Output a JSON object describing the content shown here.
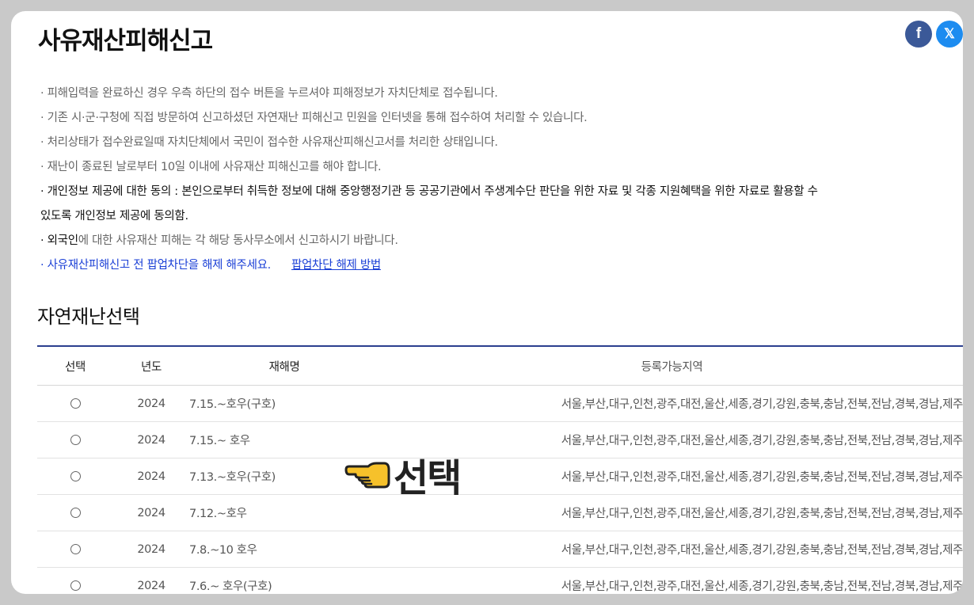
{
  "page": {
    "title": "사유재산피해신고"
  },
  "share": {
    "facebook_glyph": "f",
    "x_glyph": "𝕏"
  },
  "notices": [
    "· 피해입력을 완료하신 경우 우측 하단의 접수 버튼을 누르셔야 피해정보가 자치단체로 접수됩니다.",
    "· 기존 시·군·구청에 직접 방문하여 신고하셨던 자연재난 피해신고 민원을 인터넷을 통해 접수하여 처리할 수 있습니다.",
    "· 처리상태가 접수완료일때 자치단체에서 국민이 접수한 사유재산피해신고서를 처리한 상태입니다.",
    "· 재난이 종료된 날로부터 10일 이내에 사유재산 피해신고를 해야 합니다.",
    "· 개인정보 제공에 대한 동의 : 본인으로부터 취득한 정보에 대해 중앙행정기관 등 공공기관에서 주생계수단 판단을 위한 자료 및 각종 지원혜택을 위한 자료로 활용할 수",
    "있도록 개인정보 제공에 동의함."
  ],
  "foreigner_notice": {
    "prefix": "· ",
    "highlight": "외국인",
    "rest": "에 대한 사유재산 피해는 각 해당 동사무소에서 신고하시기 바랍니다."
  },
  "popup_notice": {
    "text": "· 사유재산피해신고 전 팝업차단을 해제 해주세요.",
    "link": "팝업차단 해제 방법"
  },
  "section": {
    "title": "자연재난선택"
  },
  "table": {
    "headers": [
      "선택",
      "년도",
      "재해명",
      "등록가능지역"
    ],
    "rows": [
      {
        "year": "2024",
        "name": "7.15.~호우(구호)",
        "region": "서울,부산,대구,인천,광주,대전,울산,세종,경기,강원,충북,충남,전북,전남,경북,경남,제주"
      },
      {
        "year": "2024",
        "name": "7.15.~ 호우",
        "region": "서울,부산,대구,인천,광주,대전,울산,세종,경기,강원,충북,충남,전북,전남,경북,경남,제주"
      },
      {
        "year": "2024",
        "name": "7.13.~호우(구호)",
        "region": "서울,부산,대구,인천,광주,대전,울산,세종,경기,강원,충북,충남,전북,전남,경북,경남,제주"
      },
      {
        "year": "2024",
        "name": "7.12.~호우",
        "region": "서울,부산,대구,인천,광주,대전,울산,세종,경기,강원,충북,충남,전북,전남,경북,경남,제주"
      },
      {
        "year": "2024",
        "name": "7.8.~10 호우",
        "region": "서울,부산,대구,인천,광주,대전,울산,세종,경기,강원,충북,충남,전북,전남,경북,경남,제주"
      },
      {
        "year": "2024",
        "name": "7.6.~ 호우(구호)",
        "region": "서울,부산,대구,인천,광주,대전,울산,세종,경기,강원,충북,충남,전북,전남,경북,경남,제주"
      }
    ]
  },
  "annotation": {
    "label": "선택",
    "icon": "pointing-hand-icon"
  },
  "colors": {
    "header_rule": "#2b3f8f",
    "link": "#1a3fd6",
    "facebook": "#3b5998",
    "x": "#1d8cf0",
    "frame_bg": "#c9c9c9"
  }
}
